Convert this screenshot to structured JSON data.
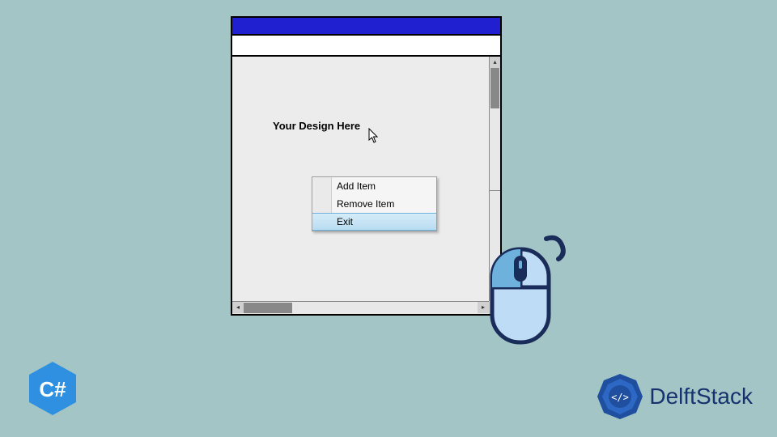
{
  "designer": {
    "label": "Your Design Here"
  },
  "context_menu": {
    "items": [
      {
        "label": "Add Item",
        "highlighted": false
      },
      {
        "label": "Remove Item",
        "highlighted": false
      },
      {
        "label": "Exit",
        "highlighted": true
      }
    ]
  },
  "branding": {
    "csharp": "C#",
    "delftstack": "DelftStack"
  }
}
